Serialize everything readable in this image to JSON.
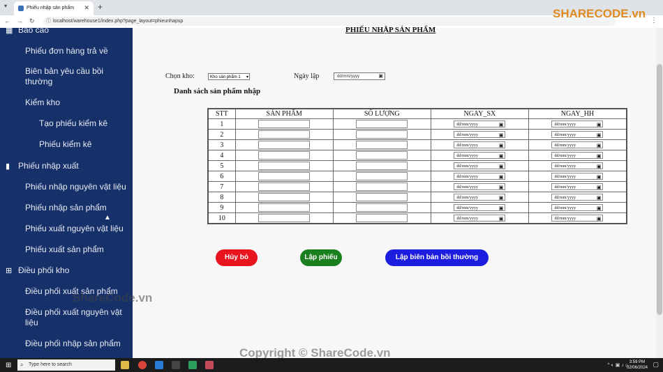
{
  "browser": {
    "tab_title": "Phiếu nhập sản phẩm",
    "url": "localhost/warehouse1/index.php?page_layout=phieunhapsp"
  },
  "sidebar": {
    "items": [
      {
        "label": "Báo cáo"
      },
      {
        "label": "Phiếu đơn hàng trả về"
      },
      {
        "label": "Biên bản yêu cầu bồi thường"
      },
      {
        "label": "Kiểm kho"
      },
      {
        "label": "Tạo phiếu kiểm kê"
      },
      {
        "label": "Phiếu kiểm kê"
      },
      {
        "label": "Phiếu nhập xuất"
      },
      {
        "label": "Phiếu nhập nguyên vật liệu"
      },
      {
        "label": "Phiếu nhập sản phẩm"
      },
      {
        "label": "Phiếu xuất nguyên vật liệu"
      },
      {
        "label": "Phiếu xuất sản phẩm"
      },
      {
        "label": "Điều phối kho"
      },
      {
        "label": "Điều phối xuất sản phẩm"
      },
      {
        "label": "Điều phối xuất nguyên vật liệu"
      },
      {
        "label": "Điều phối nhập sản phẩm"
      }
    ]
  },
  "form": {
    "title": "PHIẾU NHẬP SẢN PHẨM",
    "warehouse_label": "Chọn kho:",
    "warehouse_value": "Kho sản phẩm 1",
    "date_label": "Ngày lập",
    "date_placeholder": "dd/mm/yyyy",
    "list_title": "Danh sách sản phẩm nhập"
  },
  "table": {
    "headers": [
      "STT",
      "SẢN PHẨM",
      "SỐ LƯỢNG",
      "NGAY_SX",
      "NGAY_HH"
    ],
    "rows": [
      "1",
      "2",
      "3",
      "4",
      "5",
      "6",
      "7",
      "8",
      "9",
      "10"
    ],
    "date_placeholder": "dd/mm/yyyy"
  },
  "buttons": {
    "cancel": "Hủy bỏ",
    "create": "Lập phiếu",
    "compensation": "Lập biên bản bồi thường"
  },
  "colors": {
    "sidebar_bg": "#16306a",
    "cancel": "#e8141e",
    "create": "#1a7f1f",
    "compensation": "#1d1de0"
  },
  "watermark": {
    "logo_text": "SHARECODE.vn",
    "mid": "ShareCode.vn",
    "bottom": "Copyright © ShareCode.vn"
  },
  "taskbar": {
    "search_placeholder": "Type here to search",
    "time": "3:59 PM",
    "date": "02/06/2024"
  }
}
